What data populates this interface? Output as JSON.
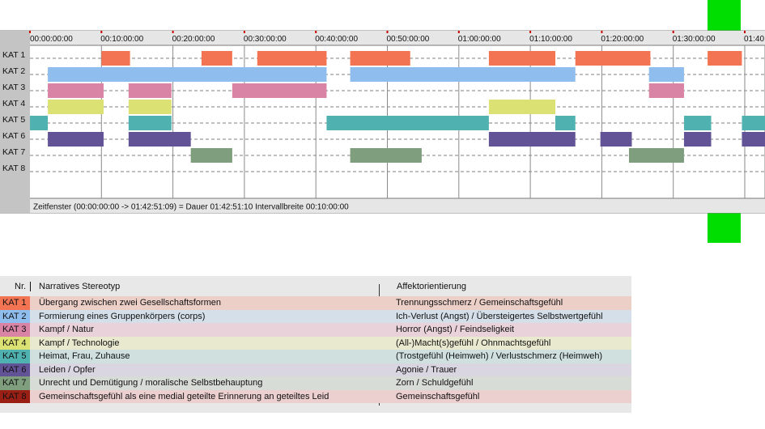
{
  "chart_data": {
    "type": "timeline",
    "time_range": [
      "00:00:00:00",
      "01:42:51:09"
    ],
    "duration": "01:42:51:10",
    "interval": "00:10:00:00",
    "tick_labels": [
      "00:00:00:00",
      "00:10:00:00",
      "00:20:00:00",
      "00:30:00:00",
      "00:40:00:00",
      "00:50:00:00",
      "01:00:00:00",
      "01:10:00:00",
      "01:20:00:00",
      "01:30:00:00",
      "01:40"
    ],
    "footer": "Zeitfenster (00:00:00:00 -> 01:42:51:09) = Dauer 01:42:51:10     Intervallbreite 00:10:00:00",
    "categories": [
      "KAT 1",
      "KAT 2",
      "KAT 3",
      "KAT 4",
      "KAT 5",
      "KAT 6",
      "KAT 7",
      "KAT 8"
    ],
    "colors": [
      "#f37453",
      "#8fbeee",
      "#d984a4",
      "#dbe173",
      "#4fb1b0",
      "#625296",
      "#7e9e7d",
      "#9a1f15"
    ],
    "segments": [
      [
        [
          10.0,
          14.0
        ],
        [
          24.0,
          28.3
        ],
        [
          31.8,
          41.5
        ],
        [
          44.8,
          53.2
        ],
        [
          64.2,
          73.5
        ],
        [
          76.3,
          86.8
        ],
        [
          94.8,
          99.6
        ]
      ],
      [
        [
          2.5,
          41.5
        ],
        [
          44.8,
          76.3
        ],
        [
          86.6,
          91.5
        ]
      ],
      [
        [
          2.5,
          10.3
        ],
        [
          13.8,
          19.8
        ],
        [
          28.3,
          41.5
        ],
        [
          86.6,
          91.5
        ]
      ],
      [
        [
          2.5,
          10.3
        ],
        [
          13.8,
          19.8
        ],
        [
          64.2,
          73.5
        ]
      ],
      [
        [
          0.0,
          2.5
        ],
        [
          13.8,
          19.8
        ],
        [
          41.5,
          64.2
        ],
        [
          73.5,
          76.3
        ],
        [
          91.5,
          95.3
        ],
        [
          99.6,
          102.85
        ]
      ],
      [
        [
          2.5,
          10.3
        ],
        [
          13.8,
          22.5
        ],
        [
          64.2,
          76.3
        ],
        [
          79.8,
          84.2
        ],
        [
          91.5,
          95.3
        ],
        [
          99.6,
          102.85
        ]
      ],
      [
        [
          22.5,
          28.3
        ],
        [
          44.8,
          54.8
        ],
        [
          83.8,
          91.5
        ]
      ],
      []
    ]
  },
  "legend": {
    "header_nr": "Nr.",
    "header_stereotyp": "Narratives Stereotyp",
    "header_affekt": "Affektorientierung",
    "rows": [
      {
        "kat": "KAT 1",
        "stereotyp": "Übergang zwischen zwei Gesellschaftsformen",
        "affekt": "Trennungsschmerz / Gemeinschaftsgefühl"
      },
      {
        "kat": "KAT 2",
        "stereotyp": "Formierung eines Gruppenkörpers (corps)",
        "affekt": "Ich-Verlust (Angst) / Übersteigertes Selbstwertgefühl"
      },
      {
        "kat": "KAT 3",
        "stereotyp": "Kampf / Natur",
        "affekt": "Horror (Angst) / Feindseligkeit"
      },
      {
        "kat": "KAT 4",
        "stereotyp": "Kampf / Technologie",
        "affekt": "(All-)Macht(s)gefühl / Ohnmachtsgefühl"
      },
      {
        "kat": "KAT 5",
        "stereotyp": "Heimat, Frau, Zuhause",
        "affekt": "(Trostgefühl (Heimweh) / Verlustschmerz (Heimweh)"
      },
      {
        "kat": "KAT 6",
        "stereotyp": "Leiden / Opfer",
        "affekt": "Agonie / Trauer"
      },
      {
        "kat": "KAT 7",
        "stereotyp": "Unrecht und Demütigung / moralische Selbstbehauptung",
        "affekt": "Zorn / Schuldgefühl"
      },
      {
        "kat": "KAT 8",
        "stereotyp": "Gemeinschaftsgefühl als eine medial geteilte Erinnerung an geteiltes Leid",
        "affekt": "Gemeinschaftsgefühl"
      }
    ],
    "row_tints": [
      "#ecd0c8",
      "#d5dfe9",
      "#e9d2da",
      "#e8e9cf",
      "#cfe0df",
      "#d9d5e1",
      "#d8dcd6",
      "#eccfcf"
    ]
  }
}
